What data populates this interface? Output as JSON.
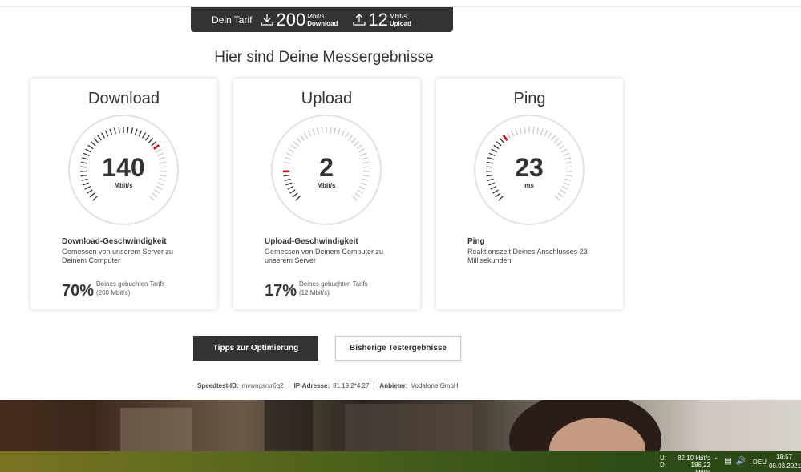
{
  "tarif": {
    "label": "Dein Tarif",
    "download_value": "200",
    "download_unit": "Mbit/s",
    "download_label": "Download",
    "upload_value": "12",
    "upload_unit": "Mbit/s",
    "upload_label": "Upload"
  },
  "page_title": "Hier sind Deine Messergebnisse",
  "cards": [
    {
      "title": "Download",
      "value": "140",
      "unit": "Mbit/s",
      "heading": "Download-Geschwindigkeit",
      "description": "Gemessen von unserem Server zu Deinem Computer",
      "percent": "70%",
      "percent_desc_line1": "Deines gebuchten Tarifs",
      "percent_desc_line2": "(200 Mbit/s)",
      "gauge_fraction": 0.7
    },
    {
      "title": "Upload",
      "value": "2",
      "unit": "Mbit/s",
      "heading": "Upload-Geschwindigkeit",
      "description": "Gemessen von Deinem Computer zu unserem Server",
      "percent": "17%",
      "percent_desc_line1": "Deines gebuchten Tarifs",
      "percent_desc_line2": "(12 Mbit/s)",
      "gauge_fraction": 0.17
    },
    {
      "title": "Ping",
      "value": "23",
      "unit": "ms",
      "heading": "Ping",
      "description": "Reaktionszeit Deines Anschlusses 23 Millisekunden",
      "gauge_fraction": 0.36
    }
  ],
  "buttons": {
    "tips": "Tipps zur Optimierung",
    "history": "Bisherige Testergebnisse"
  },
  "meta": {
    "id_label": "Speedtest-ID:",
    "id_value": "mvwngsrxr6q2",
    "ip_label": "IP-Adresse:",
    "ip_value": "31.19.2*4.27",
    "provider_label": "Anbieter:",
    "provider_value": "Vodafone GmbH"
  },
  "taskbar": {
    "upload_label": "U:",
    "download_label": "D:",
    "upload_speed": "82,10 kbit/s",
    "download_speed": "186,22 kbit/s",
    "language": "DEU",
    "time": "18:57",
    "date": "08.03.2021"
  },
  "colors": {
    "accent_red": "#e60000",
    "dark": "#333333"
  }
}
